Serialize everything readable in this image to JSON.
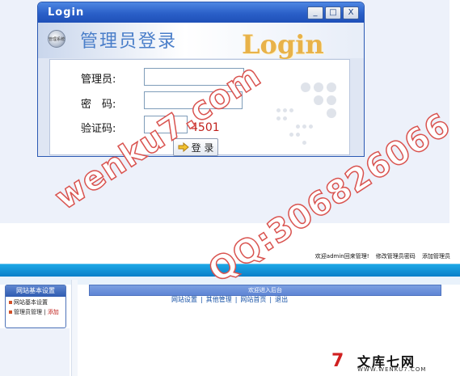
{
  "login_window": {
    "title": "Login",
    "controls": {
      "minimize": "_",
      "maximize": "□",
      "close": "X"
    },
    "header_cn": "管理员登录",
    "header_en": "Login",
    "badge_text": "管理系统",
    "form": {
      "admin_label": "管理员:",
      "password_label": "密　码:",
      "captcha_label": "验证码:",
      "admin_value": "",
      "password_value": "",
      "captcha_value": "",
      "captcha_code": "4501",
      "login_button": "登 录"
    }
  },
  "admin_panel": {
    "top_links": [
      "欢迎admin回来管理!",
      "修改管理员密码",
      "添加管理员"
    ],
    "nav": [
      "网站设置",
      "其他管理",
      "网站首页",
      "退出"
    ],
    "nav_separator": "|",
    "sidebar": {
      "title": "网站基本设置",
      "items": [
        {
          "label": "网站基本设置",
          "extra": ""
        },
        {
          "label": "管理员管理",
          "extra": "添加"
        }
      ]
    },
    "welcome": "欢迎进入后台"
  },
  "watermark": {
    "line1": "wenku7.com",
    "line2": "QQ:306826066"
  },
  "footer_brand": {
    "logo": "7",
    "name": "文库七网",
    "url": "WWW.WENKU7.COM"
  },
  "colors": {
    "titlebar": "#2a5fc8",
    "captcha": "#c0201b",
    "header_en": "#e8b24a",
    "admin_bar": "#0a7fc8",
    "watermark": "#d9534f"
  }
}
